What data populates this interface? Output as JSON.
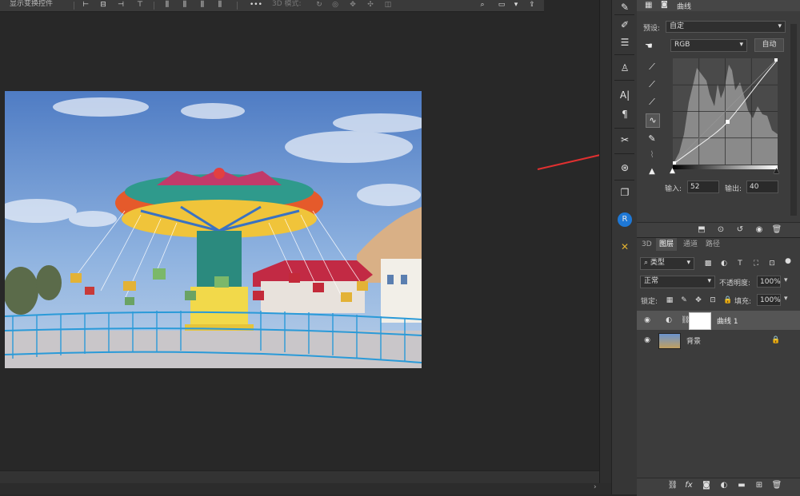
{
  "options_bar": {
    "label": "显示变换控件",
    "mode_3d": "3D 模式:"
  },
  "properties": {
    "title": "曲线",
    "preset_label": "预设:",
    "preset_value": "自定",
    "channel": "RGB",
    "auto_label": "自动",
    "input_label": "输入:",
    "input_value": "52",
    "output_label": "输出:",
    "output_value": "40"
  },
  "layers_panel": {
    "tabs": [
      "3D",
      "图层",
      "通道",
      "路径"
    ],
    "filter_kind": "类型",
    "blend_mode": "正常",
    "opacity_label": "不透明度:",
    "opacity_value": "100%",
    "lock_label": "锁定:",
    "fill_label": "填充:",
    "fill_value": "100%",
    "layers": [
      {
        "name": "曲线 1",
        "type": "adjustment",
        "visible": true,
        "selected": true
      },
      {
        "name": "背景",
        "type": "image",
        "visible": true,
        "locked": true
      }
    ]
  },
  "icons": [
    "search-icon",
    "move-icon",
    "eyedropper-icon",
    "curve-icon",
    "pencil-icon",
    "eye-icon",
    "trash-icon",
    "lock-icon",
    "link-icon",
    "fx-icon",
    "folder-icon",
    "add-layer-icon",
    "mask-icon"
  ],
  "colors": {
    "annotation_arrow": "#e03030",
    "panel_bg": "#3c3c3c",
    "canvas_bg": "#282828"
  }
}
